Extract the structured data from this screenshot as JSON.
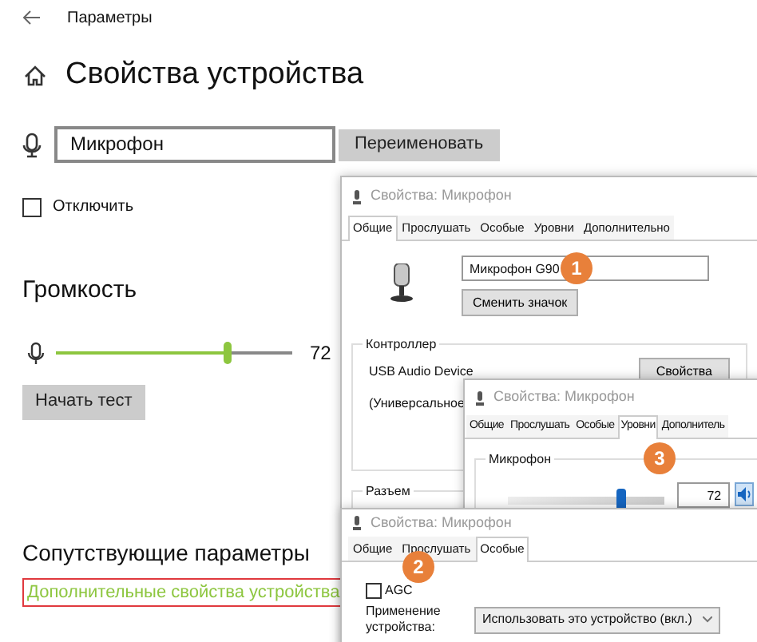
{
  "window": {
    "title": "Параметры"
  },
  "page": {
    "title": "Свойства устройства"
  },
  "device_name": {
    "value": "Микрофон"
  },
  "rename_button": "Переименовать",
  "disable": {
    "label": "Отключить",
    "checked": false
  },
  "volume": {
    "heading": "Громкость",
    "level": 0.72,
    "reading": "72"
  },
  "test_button": "Начать тест",
  "related": {
    "heading": "Сопутствующие параметры",
    "link": "Дополнительные свойства устройства"
  },
  "general_dialog": {
    "title": "Свойства: Микрофон",
    "tabs": [
      {
        "label": "Общие",
        "selected": true
      },
      {
        "label": "Прослушать",
        "selected": false
      },
      {
        "label": "Особые",
        "selected": false
      },
      {
        "label": "Уровни",
        "selected": false
      },
      {
        "label": "Дополнительно",
        "selected": false
      }
    ],
    "name_value": "Микрофон G90",
    "change_icon_button": "Сменить значок",
    "controller": {
      "heading": "Контроллер",
      "device": "USB Audio Device",
      "properties_button": "Свойства",
      "driver": "(Универсальное"
    },
    "jack": {
      "heading": "Разъем"
    }
  },
  "levels_dialog": {
    "title": "Свойства: Микрофон",
    "tabs": [
      {
        "label": "Общие",
        "selected": false
      },
      {
        "label": "Прослушать",
        "selected": false
      },
      {
        "label": "Особые",
        "selected": false
      },
      {
        "label": "Уровни",
        "selected": true
      },
      {
        "label": "Дополнитель",
        "selected": false
      }
    ],
    "group": "Микрофон",
    "level": 0.72,
    "value": "72"
  },
  "advanced_dialog": {
    "title": "Свойства: Микрофон",
    "tabs": [
      {
        "label": "Общие",
        "selected": false
      },
      {
        "label": "Прослушать",
        "selected": false
      },
      {
        "label": "Особые",
        "selected": true
      }
    ],
    "agc": {
      "label": "AGC",
      "checked": false
    },
    "usage_label": "Применение устройства:",
    "usage_value": "Использовать это устройство (вкл.)"
  },
  "markers": [
    {
      "label": "1"
    },
    {
      "label": "2"
    },
    {
      "label": "3"
    }
  ]
}
